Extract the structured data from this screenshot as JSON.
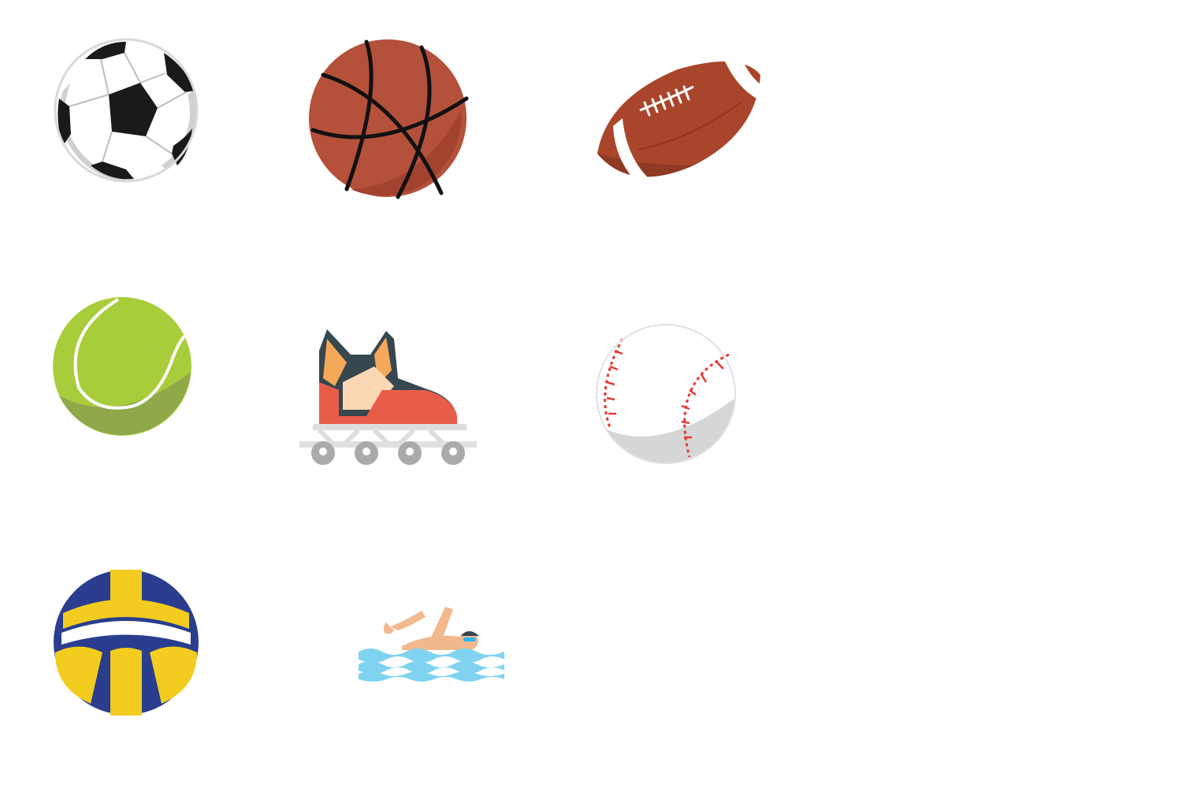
{
  "background_color": "#ffffff",
  "icons": [
    {
      "name": "soccer-ball-icon",
      "colors": {
        "main": "#ffffff",
        "patch": "#1a1a1a",
        "shade": "#cfcfcf"
      }
    },
    {
      "name": "basketball-icon",
      "colors": {
        "main": "#b5503a",
        "shade": "#a2432f",
        "line": "#111111"
      }
    },
    {
      "name": "american-football-icon",
      "colors": {
        "main": "#a9452b",
        "shade": "#8f3a24",
        "stripe": "#ffffff"
      }
    },
    {
      "name": "tennis-ball-icon",
      "colors": {
        "main": "#a8cd3b",
        "shade": "#8fa84a",
        "seam": "#ffffff"
      }
    },
    {
      "name": "inline-skate-icon",
      "colors": {
        "boot": "#e85c4a",
        "accent": "#f5a85a",
        "light": "#fbd7b3",
        "dark": "#37474f",
        "frame": "#dddddd",
        "wheel": "#aaaaaa"
      }
    },
    {
      "name": "baseball-icon",
      "colors": {
        "main": "#ffffff",
        "shade": "#d6d6d6",
        "stitch": "#e53935"
      }
    },
    {
      "name": "volleyball-icon",
      "colors": {
        "blue": "#2a3d8f",
        "yellow": "#f2cc1e",
        "white": "#ffffff"
      }
    },
    {
      "name": "swimmer-icon",
      "colors": {
        "skin": "#f2b98e",
        "water": "#7fd3f0",
        "wave": "#4fc3f7",
        "cap": "#37474f",
        "goggles": "#29b6f6"
      }
    }
  ]
}
